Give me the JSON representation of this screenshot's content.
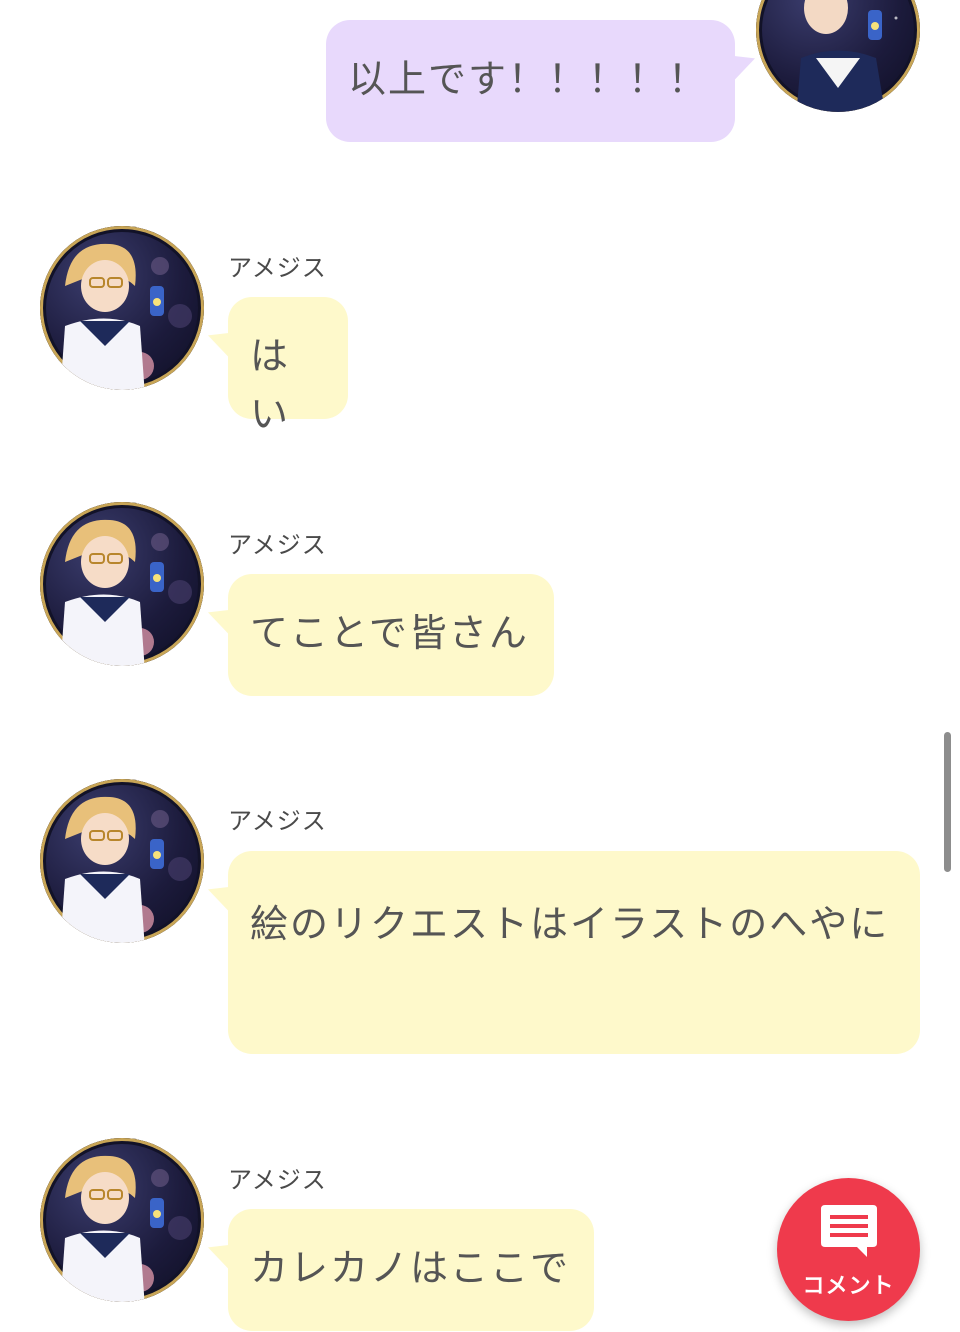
{
  "chat": {
    "outgoing": [
      {
        "text": "以上です！！！！！"
      }
    ],
    "messages": [
      {
        "sender": "アメジス",
        "text": "はい"
      },
      {
        "sender": "アメジス",
        "text": "てことで皆さん"
      },
      {
        "sender": "アメジス",
        "text": "絵のリクエストはイラストのへやに"
      },
      {
        "sender": "アメジス",
        "text": "カレカノはここで"
      }
    ]
  },
  "fab": {
    "label": "コメント",
    "icon": "comment-icon"
  },
  "colors": {
    "incoming_bubble": "#fef9cb",
    "outgoing_bubble": "#e8d9fc",
    "fab": "#ef3a4c"
  }
}
